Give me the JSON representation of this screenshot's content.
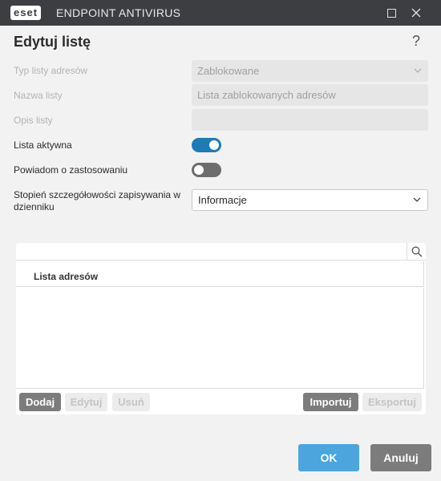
{
  "titlebar": {
    "logo_text": "eset",
    "product_name": "ENDPOINT ANTIVIRUS",
    "maximize_icon": "maximize-icon",
    "close_icon": "close-icon"
  },
  "dialog": {
    "title": "Edytuj listę",
    "help_label": "?"
  },
  "form": {
    "list_type": {
      "label": "Typ listy adresów",
      "value": "Zablokowane"
    },
    "list_name": {
      "label": "Nazwa listy",
      "value": "Lista zablokowanych adresów"
    },
    "list_description": {
      "label": "Opis listy",
      "value": ""
    },
    "list_active": {
      "label": "Lista aktywna",
      "checked": true
    },
    "notify_on_apply": {
      "label": "Powiadom o zastosowaniu",
      "checked": false
    },
    "log_verbosity": {
      "label": "Stopień szczegółowości zapisywania w dzienniku",
      "value": "Informacje"
    }
  },
  "address_list": {
    "search_placeholder": "",
    "column_header": "Lista adresów",
    "rows": []
  },
  "panel_buttons": {
    "add": "Dodaj",
    "edit": "Edytuj",
    "remove": "Usuń",
    "import": "Importuj",
    "export": "Eksportuj"
  },
  "footer": {
    "ok": "OK",
    "cancel": "Anuluj"
  },
  "colors": {
    "accent": "#1f7ab5",
    "ok_button": "#4ca5dc",
    "titlebar": "#3c3e41"
  }
}
